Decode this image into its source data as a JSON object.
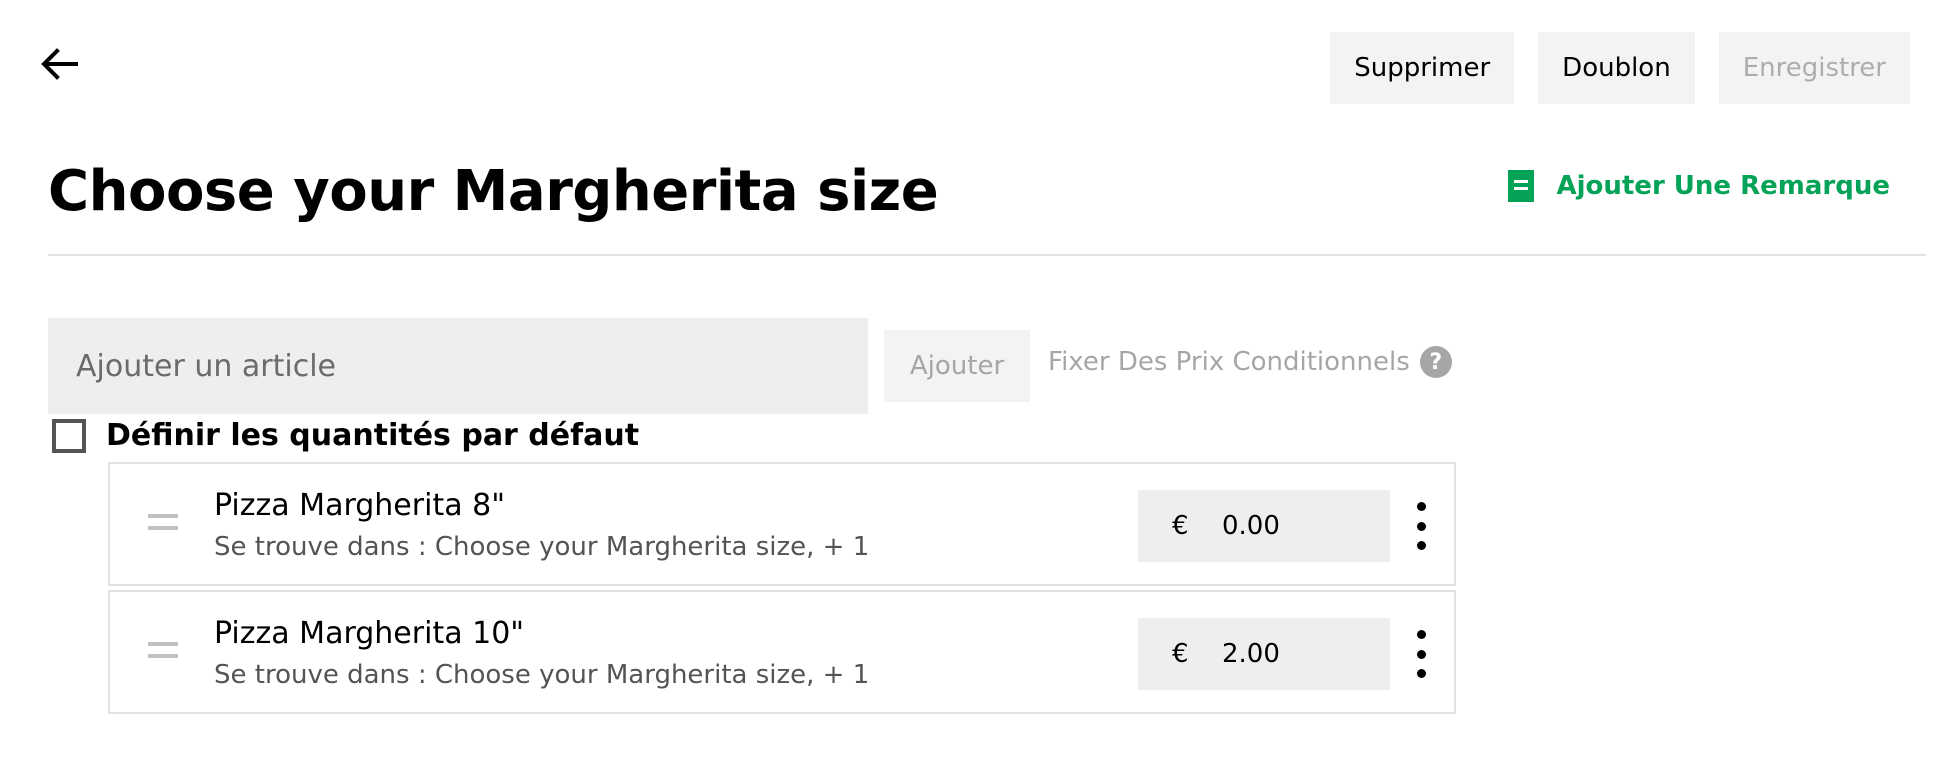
{
  "header": {
    "back_icon": "arrow-left-icon",
    "actions": {
      "delete_label": "Supprimer",
      "duplicate_label": "Doublon",
      "save_label": "Enregistrer"
    }
  },
  "page": {
    "title": "Choose your Margherita size",
    "add_note_label": "Ajouter Une Remarque",
    "add_note_icon": "note-icon",
    "accent_color": "#05a357"
  },
  "add_item": {
    "placeholder": "Ajouter un article",
    "value": "",
    "button_label": "Ajouter",
    "conditional_prices_label": "Fixer Des Prix Conditionnels",
    "help_icon": "question-circle-icon",
    "help_glyph": "?"
  },
  "default_quantities": {
    "label": "Définir les quantités par défaut",
    "checked": false
  },
  "items": [
    {
      "name": "Pizza Margherita 8\"",
      "location": "Se trouve dans : Choose your Margherita size, + 1",
      "currency": "€",
      "price": "0.00"
    },
    {
      "name": "Pizza Margherita 10\"",
      "location": "Se trouve dans : Choose your Margherita size, + 1",
      "currency": "€",
      "price": "2.00"
    }
  ]
}
